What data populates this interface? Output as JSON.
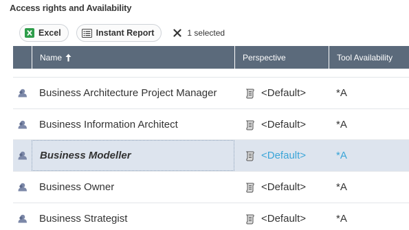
{
  "panel": {
    "title": "Access rights and Availability"
  },
  "toolbar": {
    "excel_label": "Excel",
    "report_label": "Instant Report",
    "selection_label": "1 selected"
  },
  "table": {
    "columns": {
      "name": "Name",
      "perspective": "Perspective",
      "tool_availability": "Tool Availability"
    },
    "sort": {
      "column": "name",
      "direction": "ascending"
    },
    "rows": [
      {
        "name": "Business Architecture Project Manager",
        "perspective": "<Default>",
        "tool_availability": "*A",
        "selected": false
      },
      {
        "name": "Business Information Architect",
        "perspective": "<Default>",
        "tool_availability": "*A",
        "selected": false
      },
      {
        "name": "Business Modeller",
        "perspective": "<Default>",
        "tool_availability": "*A",
        "selected": true
      },
      {
        "name": "Business Owner",
        "perspective": "<Default>",
        "tool_availability": "*A",
        "selected": false
      },
      {
        "name": "Business Strategist",
        "perspective": "<Default>",
        "tool_availability": "*A",
        "selected": false
      }
    ]
  },
  "icons": {
    "excel": "excel-icon",
    "report": "report-icon",
    "clear_selection": "close-icon",
    "sort": "sort-up-arrow-icon",
    "row": "user-icon",
    "perspective": "scroll-icon"
  },
  "colors": {
    "header_bg": "#5b6a7b",
    "selected_row_bg": "#dde4ee",
    "selected_text": "#3aa5d8",
    "excel_green": "#2e9d4a"
  }
}
